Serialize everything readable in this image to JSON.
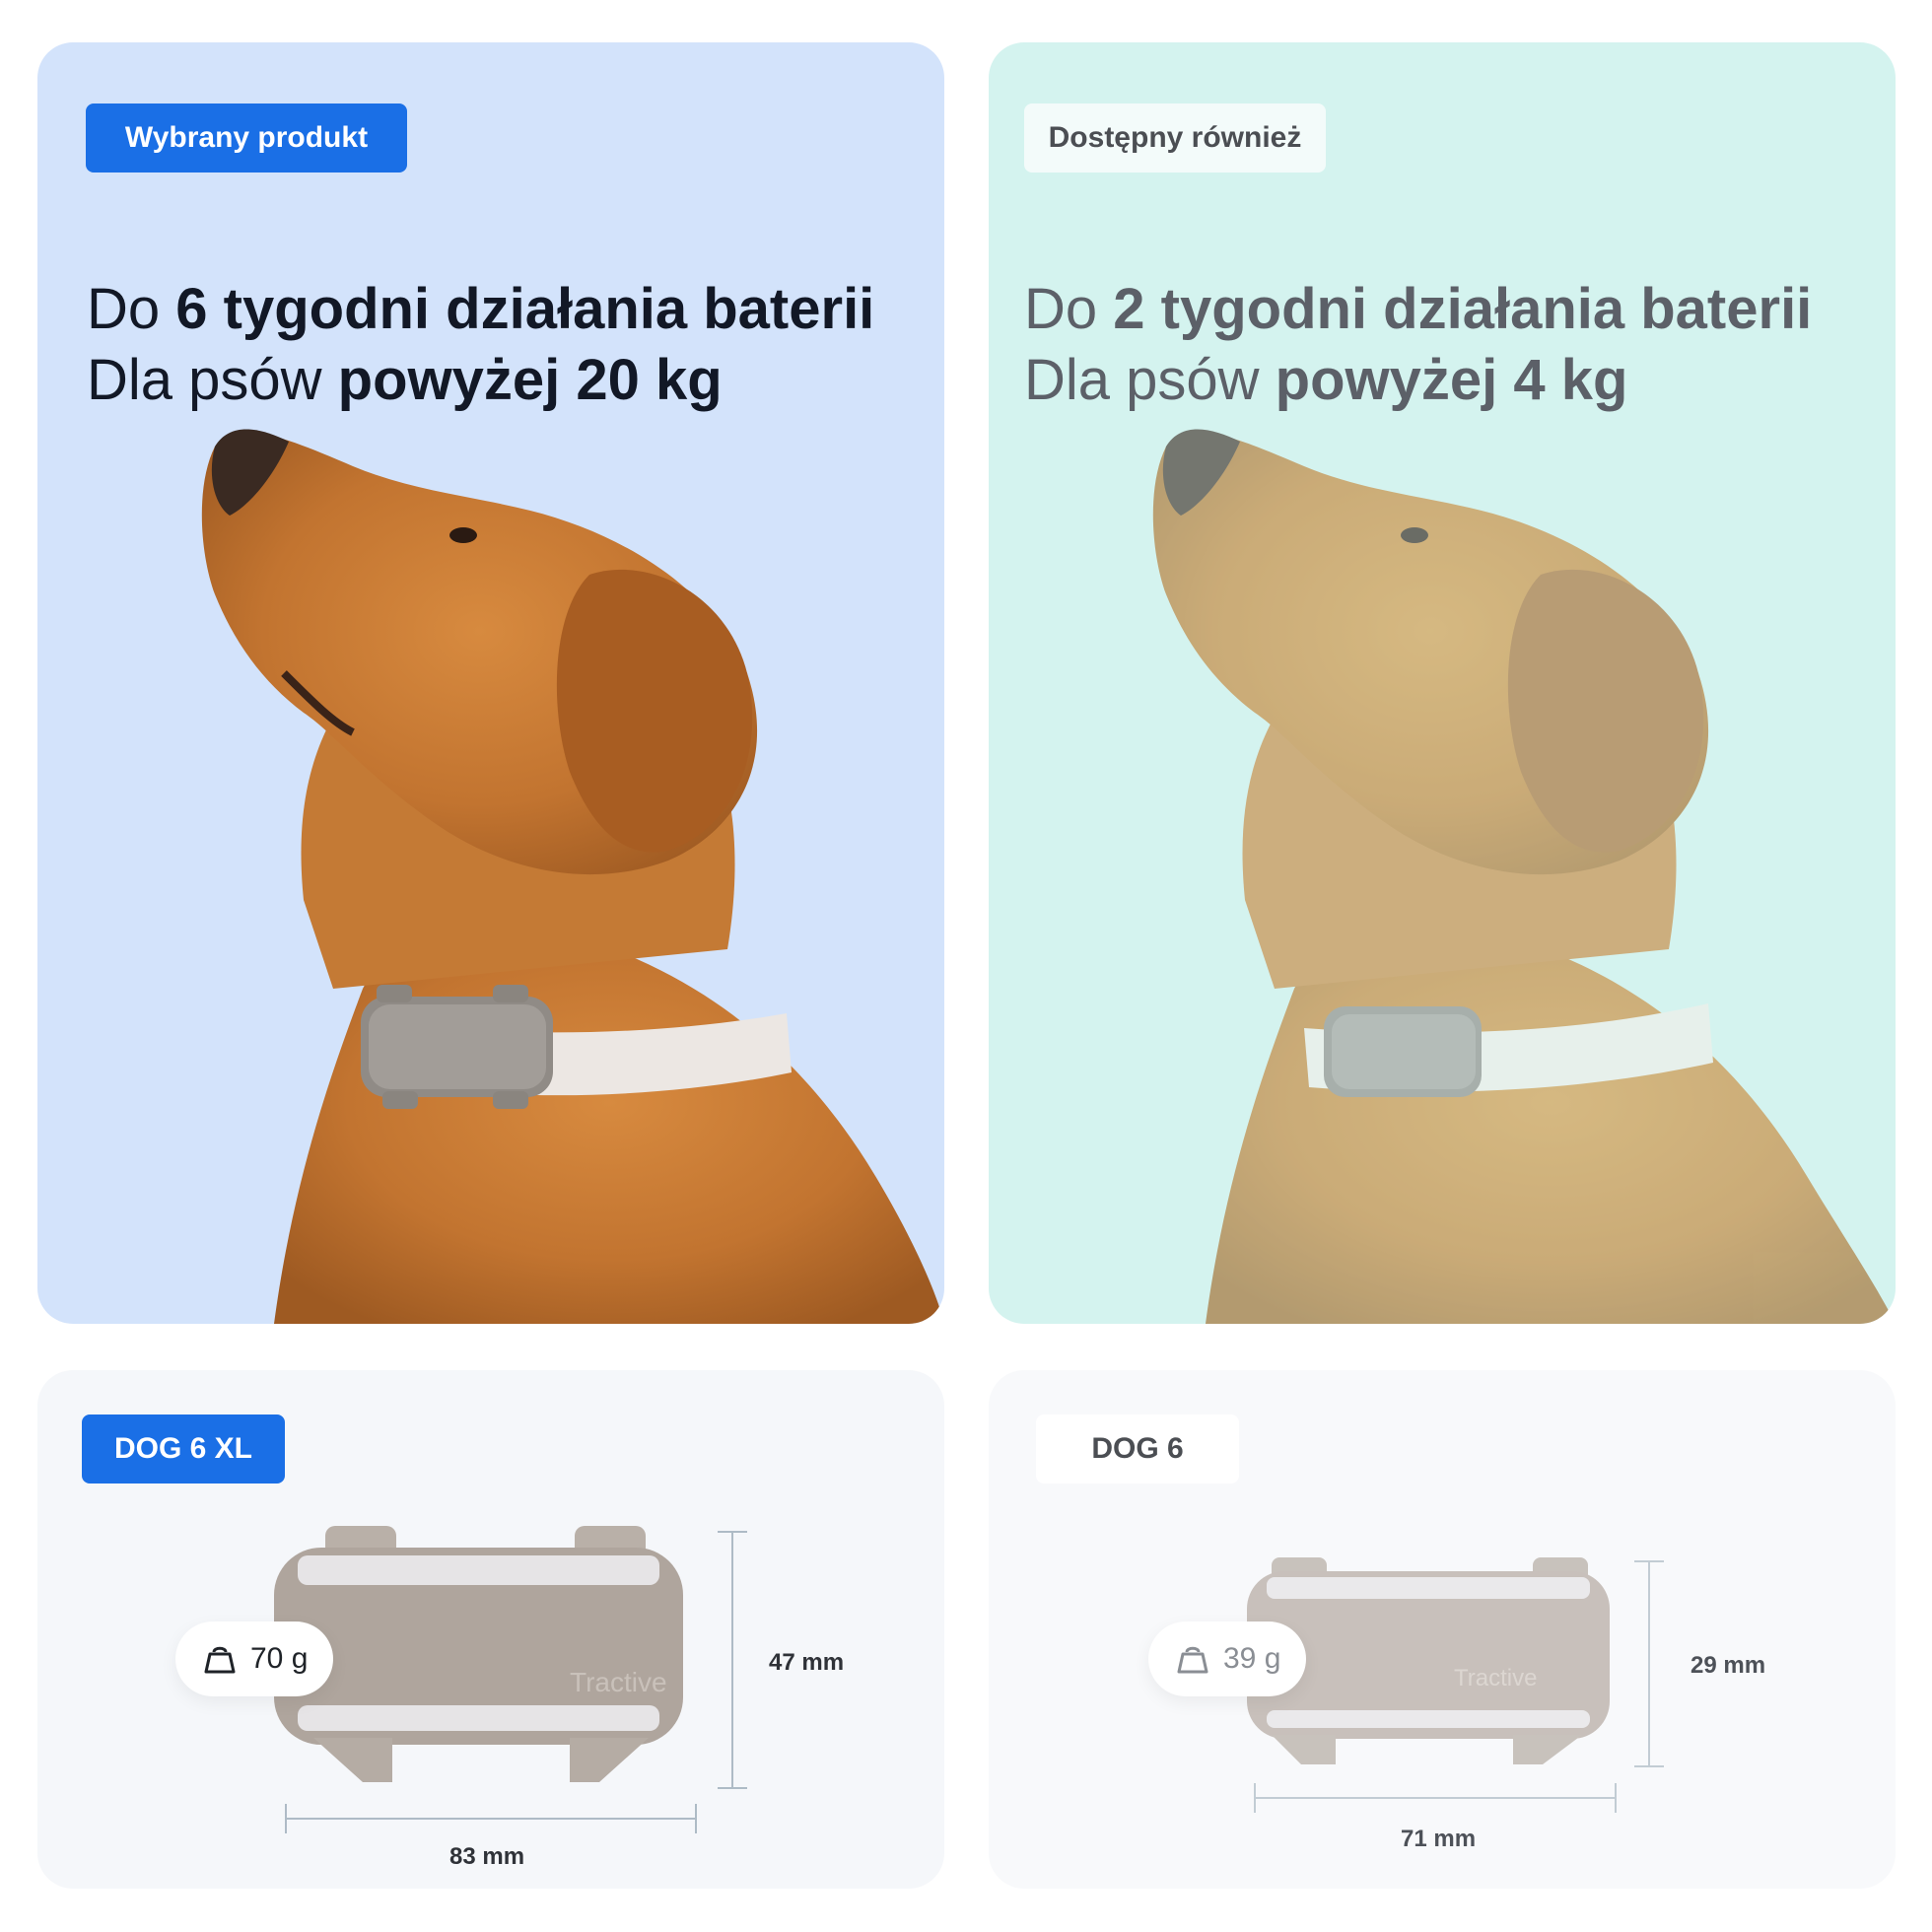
{
  "comparison": {
    "selected": {
      "badge": "Wybrany produkt",
      "battery_prefix": "Do ",
      "battery_bold": "6 tygodni działania baterii",
      "weight_prefix": "Dla psów ",
      "weight_bold": "powyżej 20 kg",
      "model": "DOG 6 XL",
      "device_weight": "70 g",
      "height": "47 mm",
      "width": "83 mm"
    },
    "alternative": {
      "badge": "Dostępny również",
      "battery_prefix": "Do ",
      "battery_bold": "2 tygodni działania baterii",
      "weight_prefix": "Dla psów ",
      "weight_bold": "powyżej 4 kg",
      "model": "DOG 6",
      "device_weight": "39 g",
      "height": "29 mm",
      "width": "71 mm"
    }
  },
  "device_logo": "Tractive",
  "colors": {
    "accent_blue": "#1a6fe6",
    "panel_blue": "#d3e3fb",
    "panel_mint": "#d4f3ef",
    "text_dark": "#121826",
    "text_muted": "#5c6068"
  },
  "icons": [
    "weight-icon"
  ]
}
